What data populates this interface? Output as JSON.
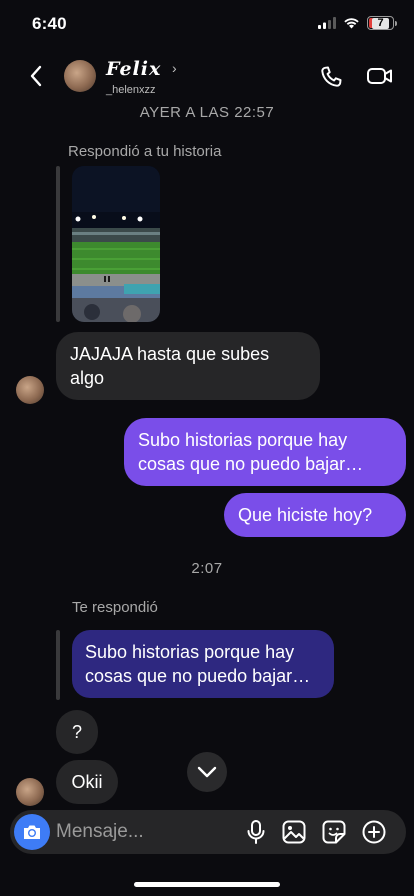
{
  "status_bar": {
    "time": "6:40",
    "battery": "7"
  },
  "header": {
    "name": "Felix",
    "username": "_helenxzz"
  },
  "timestamps": {
    "first": "AYER A LAS 22:57",
    "second": "2:07"
  },
  "story_reply": {
    "label": "Respondió a tu historia"
  },
  "messages": {
    "in_1": "JAJAJA hasta que subes algo",
    "out_1": "Subo historias porque hay cosas que no puedo bajar…",
    "out_2": "Que hiciste hoy?",
    "reply_label": "Te respondió",
    "quoted": "Subo historias porque hay cosas que no puedo bajar…",
    "in_2": "?",
    "in_3": "Okii"
  },
  "composer": {
    "placeholder": "Mensaje..."
  },
  "colors": {
    "outgoing": "#7a4ee9",
    "quoted": "#2e2880",
    "incoming": "#262628",
    "camera": "#3e7cf6"
  }
}
